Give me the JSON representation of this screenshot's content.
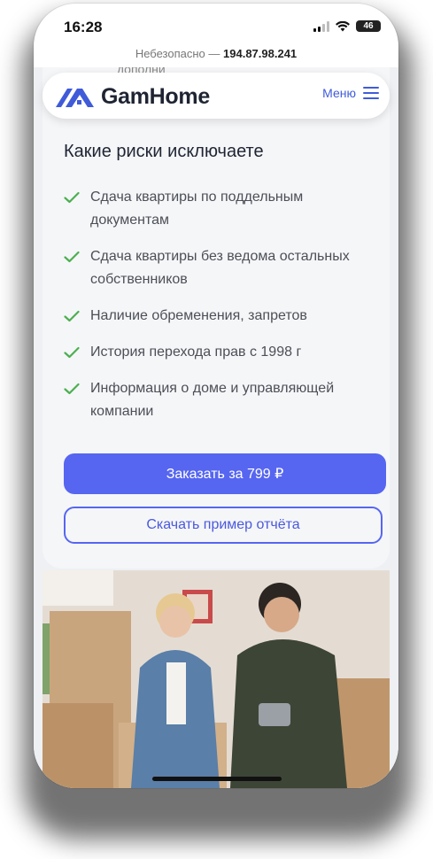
{
  "status_bar": {
    "time": "16:28",
    "battery": "46"
  },
  "browser": {
    "security_label": "Небезопасно —",
    "address": "194.87.98.241"
  },
  "partial_text": "дополни",
  "header": {
    "logo_text": "GamHome",
    "menu_label": "Меню"
  },
  "risks_section": {
    "title": "Какие риски исключаете",
    "items": [
      "Сдача квартиры по поддельным документам",
      "Сдача квартиры без ведома остальных собственников",
      "Наличие обременения, запретов",
      "История перехода прав с 1998 г",
      "Информация о доме и управляющей компании"
    ]
  },
  "actions": {
    "order_label": "Заказать за 799 ₽",
    "sample_label": "Скачать пример отчёта"
  },
  "colors": {
    "accent": "#5666f0",
    "check": "#4caf50",
    "card_bg": "#f5f6f8"
  },
  "icons": {
    "menu": "hamburger-icon",
    "check": "check-icon",
    "logo": "house-logo-icon"
  }
}
